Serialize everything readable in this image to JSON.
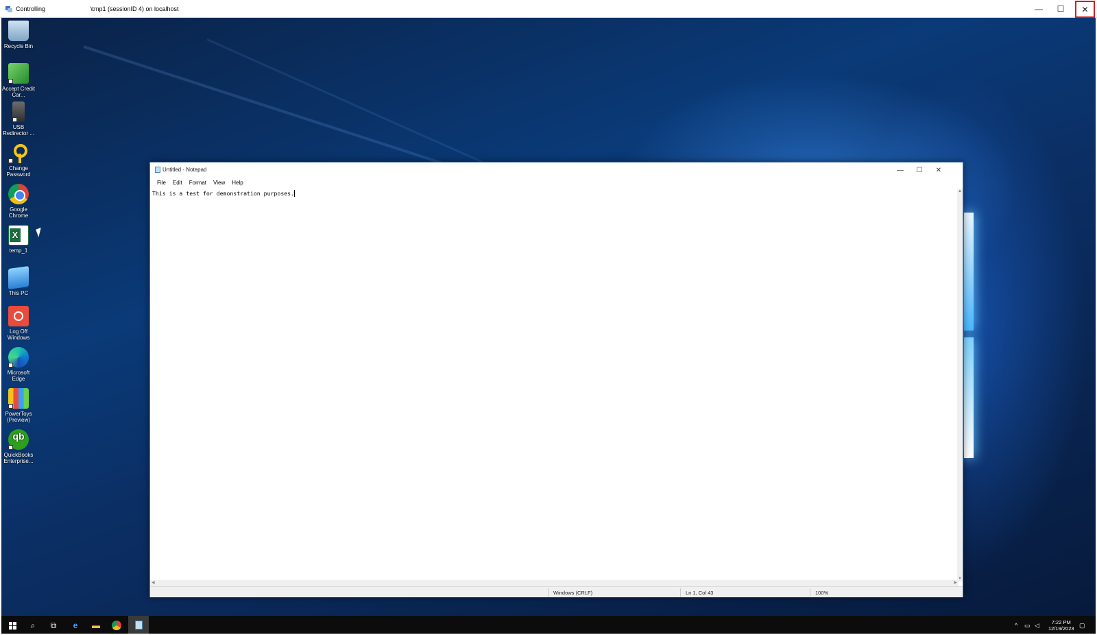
{
  "outer_window": {
    "app_name": "Controlling",
    "session_title": "\\tmp1 (sessionID 4) on localhost",
    "annotation_marker": "1",
    "minimize_glyph": "—",
    "maximize_glyph": "☐",
    "close_glyph": "✕"
  },
  "desktop_icons": [
    {
      "label": "Recycle Bin",
      "icon": "recycle-bin-icon"
    },
    {
      "label": "Accept Credit Car...",
      "icon": "credit-card-icon"
    },
    {
      "label": "USB Redirector ...",
      "icon": "usb-redirector-icon"
    },
    {
      "label": "Change Password",
      "icon": "key-icon"
    },
    {
      "label": "Google Chrome",
      "icon": "chrome-icon"
    },
    {
      "label": "temp_1",
      "icon": "excel-icon"
    },
    {
      "label": "This PC",
      "icon": "computer-icon"
    },
    {
      "label": "Log Off Windows",
      "icon": "power-icon"
    },
    {
      "label": "Microsoft Edge",
      "icon": "edge-icon"
    },
    {
      "label": "PowerToys (Preview)",
      "icon": "powertoys-icon"
    },
    {
      "label": "QuickBooks Enterprise...",
      "icon": "quickbooks-icon"
    }
  ],
  "notepad": {
    "title": "Untitled - Notepad",
    "menu": [
      "File",
      "Edit",
      "Format",
      "View",
      "Help"
    ],
    "content": "This is a test for demonstration purposes.",
    "status": {
      "line_ending": "Windows (CRLF)",
      "position": "Ln 1, Col 43",
      "zoom": "100%"
    }
  },
  "taskbar": {
    "apps": [
      "start-icon",
      "search-icon",
      "task-view-icon",
      "internet-explorer-icon",
      "file-explorer-icon",
      "chrome-icon",
      "notepad-icon"
    ],
    "clock_time": "7:22 PM",
    "clock_date": "12/19/2023"
  }
}
